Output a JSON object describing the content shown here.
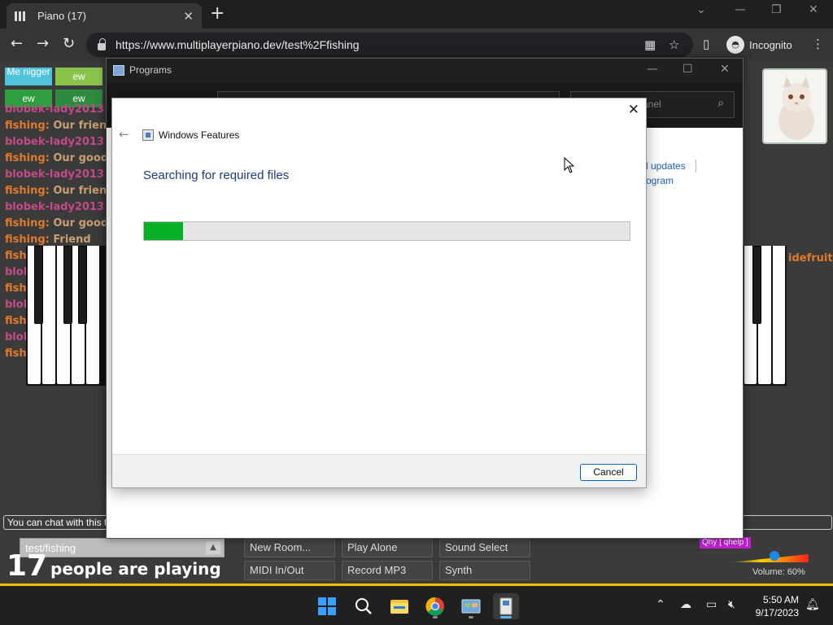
{
  "browser": {
    "tab_title": "Piano (17)",
    "new_tab": "+",
    "url": "https://www.multiplayerpiano.dev/test%2Ffishing",
    "profile_label": "Incognito",
    "window_controls": [
      "minimize-icon",
      "restore-icon",
      "close-icon"
    ]
  },
  "piano": {
    "users": [
      {
        "label": "Me nigger",
        "color": "#4fc3d9"
      },
      {
        "label": "ew",
        "color": "#8bc34a"
      },
      {
        "label": "ew",
        "color": "#2e9e3e"
      },
      {
        "label": "ew",
        "color": "#2e8b3e"
      }
    ],
    "chat": [
      {
        "name": "blobek-lady2013",
        "msg": "",
        "kind": "blob"
      },
      {
        "name": "fishing:",
        "msg": "Our frien",
        "kind": "fish"
      },
      {
        "name": "blobek-lady2013",
        "msg": "",
        "kind": "blob"
      },
      {
        "name": "fishing:",
        "msg": "Our good",
        "kind": "fish"
      },
      {
        "name": "blobek-lady2013",
        "msg": "",
        "kind": "blob"
      },
      {
        "name": "fishing:",
        "msg": "Our frien",
        "kind": "fish"
      },
      {
        "name": "blobek-lady2013",
        "msg": "",
        "kind": "blob"
      },
      {
        "name": "fishing:",
        "msg": "Our good",
        "kind": "fish"
      },
      {
        "name": "fishing:",
        "msg": "Friend",
        "kind": "fish"
      },
      {
        "name": "fishing:",
        "msg": "Our good",
        "kind": "fish"
      },
      {
        "name": "blobek-lady2013",
        "msg": "",
        "kind": "blob"
      },
      {
        "name": "fishing:",
        "msg": "Our frien",
        "kind": "fish"
      },
      {
        "name": "blobek-lady2013",
        "msg": "",
        "kind": "blob"
      },
      {
        "name": "fishing:",
        "msg": "Our frien",
        "kind": "fish"
      },
      {
        "name": "blobek-lady2013",
        "msg": "",
        "kind": "blob"
      },
      {
        "name": "fishing:",
        "msg": "Our frien",
        "kind": "fish"
      }
    ],
    "side_text": "idefruit",
    "chat_placeholder": "You can chat with this thing.",
    "room_name": "test/fishing",
    "people_count": "17",
    "people_label": "people are playing",
    "buttons": [
      "New Room...",
      "Play Alone",
      "Sound Select",
      "MIDI In/Out",
      "Record MP3",
      "Synth"
    ],
    "qhy_tag": "Qhy [ qhelp ]",
    "volume_label": "Volume: 60%"
  },
  "control_panel": {
    "title": "Programs",
    "search_placeholder": "anel",
    "link_updates": "d updates",
    "link_program": "rogram"
  },
  "dialog": {
    "title": "Windows Features",
    "heading": "Searching for required files",
    "progress": 0.08,
    "cancel_label": "Cancel",
    "accent_color": "#06b025"
  },
  "taskbar": {
    "apps": [
      "windows-start-icon",
      "search-icon",
      "file-explorer-icon",
      "chrome-icon",
      "control-panel-icon",
      "windows-features-icon"
    ],
    "time": "5:50 AM",
    "date": "9/17/2023"
  }
}
